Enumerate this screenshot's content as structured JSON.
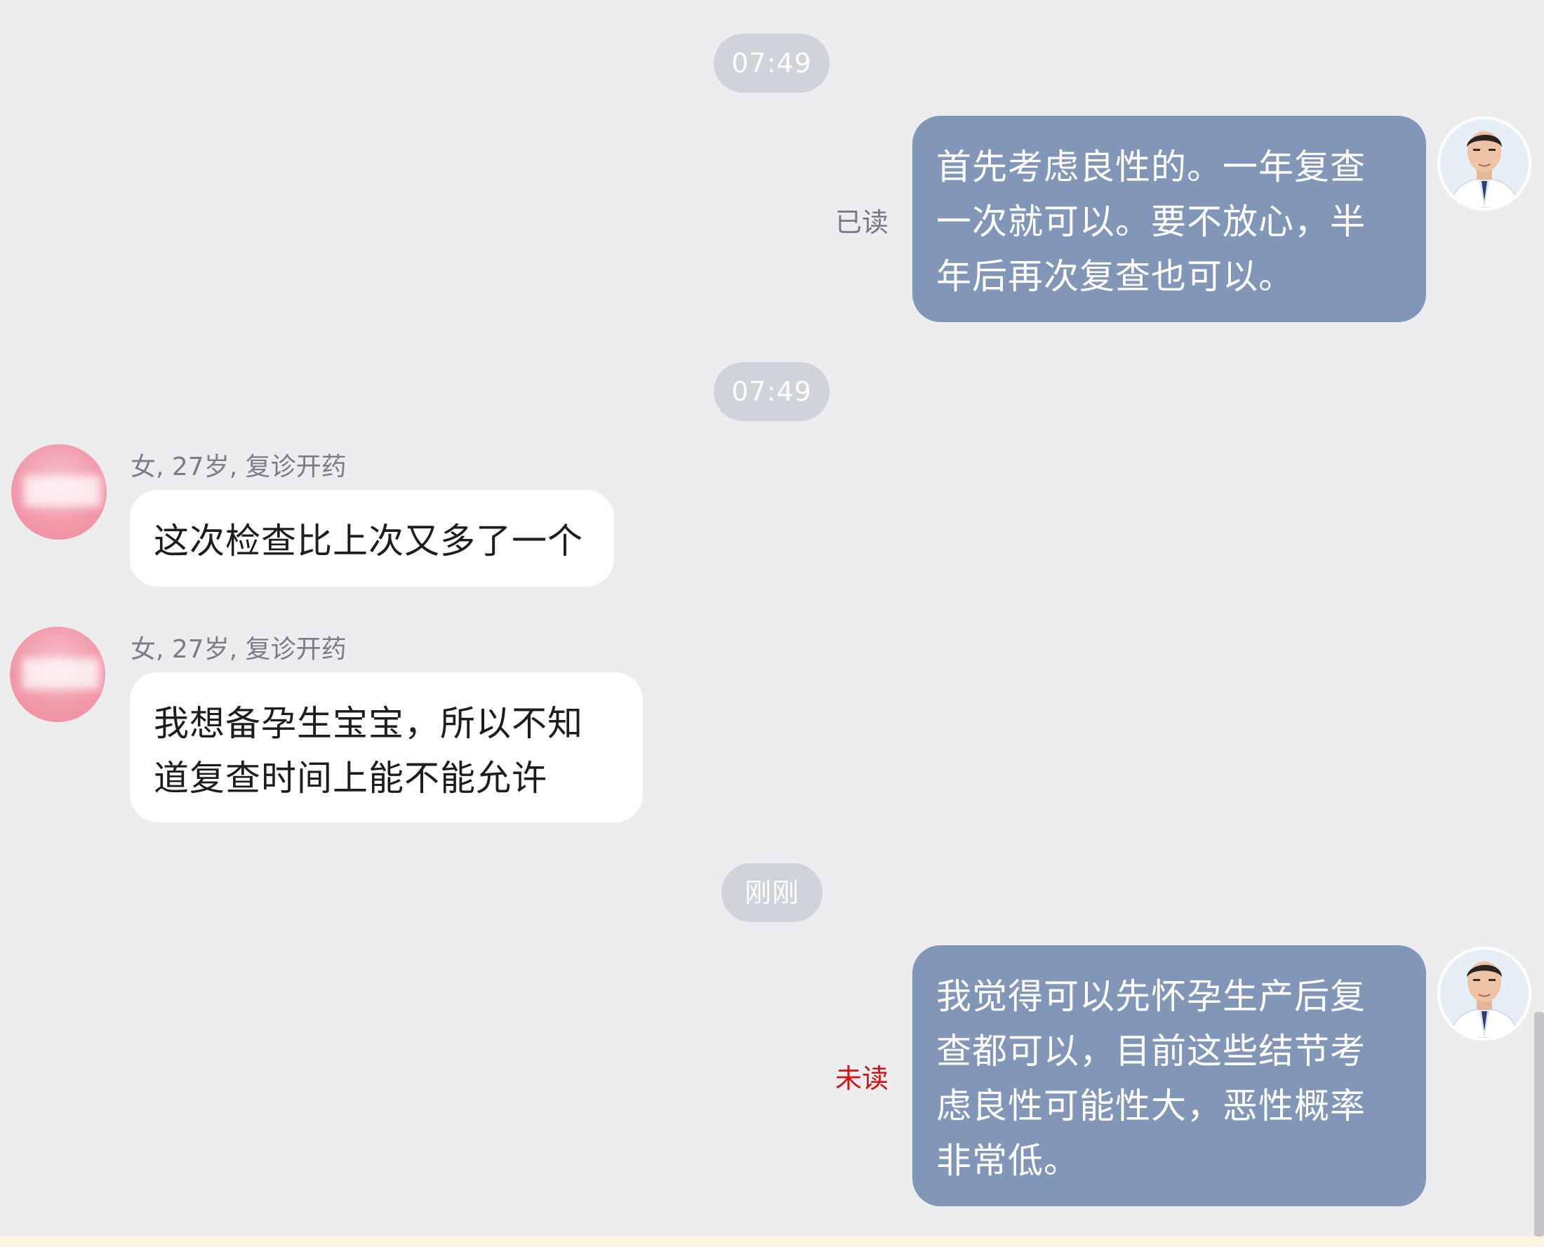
{
  "conversation": [
    {
      "type": "timestamp",
      "text": "07:49"
    },
    {
      "type": "message",
      "direction": "outgoing",
      "status": "已读",
      "lines": [
        "首先考虑良性的。一年复查",
        "一次就可以。要不放心，半",
        "年后再次复查也可以。"
      ]
    },
    {
      "type": "timestamp",
      "text": "07:49"
    },
    {
      "type": "message",
      "direction": "incoming",
      "sender_meta": "女, 27岁, 复诊开药",
      "lines": [
        "这次检查比上次又多了一个"
      ]
    },
    {
      "type": "message",
      "direction": "incoming",
      "sender_meta": "女, 27岁, 复诊开药",
      "lines": [
        "我想备孕生宝宝，所以不知",
        "道复查时间上能不能允许"
      ]
    },
    {
      "type": "timestamp",
      "text": "刚刚"
    },
    {
      "type": "message",
      "direction": "outgoing",
      "status": "未读",
      "lines": [
        "我觉得可以先怀孕生产后复",
        "查都可以，目前这些结节考",
        "虑良性可能性大，恶性概率",
        "非常低。"
      ]
    }
  ],
  "colors": {
    "background": "#ededf0",
    "outgoing_bubble": "#8296b8",
    "incoming_bubble": "#ffffff",
    "timestamp_pill": "#d0d3da",
    "unread_status": "#d31212",
    "read_status": "#777a80"
  },
  "icons": {
    "doctor_avatar": "doctor-photo-icon",
    "patient_avatar": "blurred-pink-avatar-icon"
  }
}
